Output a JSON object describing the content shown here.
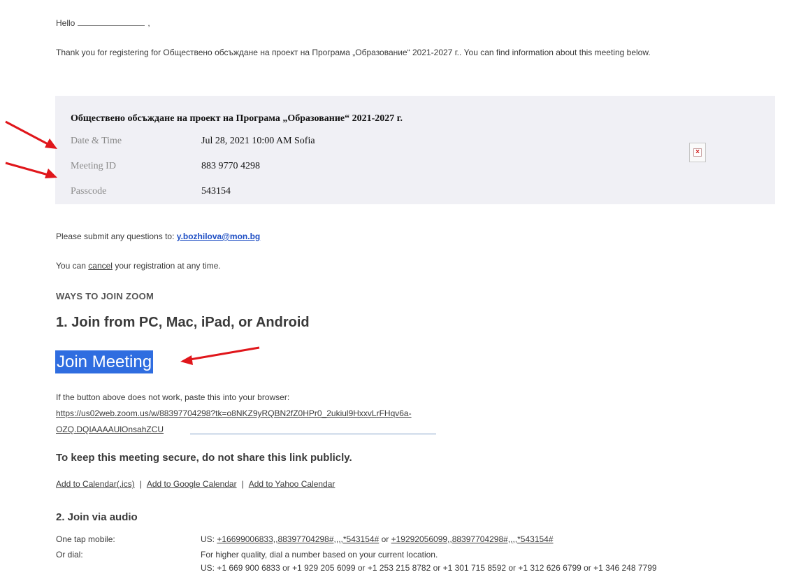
{
  "greeting": {
    "hello": "Hello",
    "comma": ","
  },
  "intro": "Thank you for registering for Обществено обсъждане на проект на Програма „Образование“ 2021-2027 г.. You can find information about this meeting below.",
  "meeting": {
    "title": "Обществено обсъждане на проект на Програма „Образование“ 2021-2027 г.",
    "date_label": "Date & Time",
    "date_value": "Jul 28, 2021 10:00 AM Sofia",
    "id_label": "Meeting ID",
    "id_value": "883 9770 4298",
    "pass_label": "Passcode",
    "pass_value": "543154",
    "broken_image_icon": "broken-image-icon"
  },
  "questions": {
    "prefix": "Please submit any questions to:",
    "email": "y.bozhilova@mon.bg"
  },
  "cancel": {
    "prefix": "You can",
    "link": "cancel",
    "suffix": "your registration at any time."
  },
  "ways_heading": "WAYS TO JOIN ZOOM",
  "join_pc": {
    "heading": "1. Join from PC, Mac, iPad, or Android",
    "button": "Join Meeting",
    "fallback_text": "If the button above does not work, paste this into your browser:",
    "url_line1": "https://us02web.zoom.us/w/88397704298?tk=o8NKZ9yRQBN2fZ0HPr0_2ukiul9HxxvLrFHqv6a-",
    "url_line2": "OZQ.DQIAAAAUlOnsahZCU",
    "secure_note": "To keep this meeting secure, do not share this link publicly.",
    "calendars": [
      "Add to Calendar(.ics)",
      "Add to Google Calendar",
      "Add to Yahoo Calendar"
    ],
    "calendar_sep": "|"
  },
  "join_audio": {
    "heading": "2. Join via audio",
    "onetap_label": "One tap mobile:",
    "onetap_prefix": "US:",
    "onetap_num1": "+16699006833,,88397704298#,,,,*543154#",
    "onetap_or": "or",
    "onetap_num2": "+19292056099,,88397704298#,,,,*543154#",
    "dial_label": "Or dial:",
    "dial_line1": "For higher quality, dial a number based on your current location.",
    "dial_line2": "US: +1 669 900 6833 or +1 929 205 6099 or +1 253 215 8782 or +1 301 715 8592 or +1 312 626 6799 or +1 346 248 7799"
  },
  "colors": {
    "arrow": "#e0161b",
    "join_button": "#2f6de0",
    "card_bg": "#f0f0f5",
    "email_link": "#1f4fc4"
  }
}
